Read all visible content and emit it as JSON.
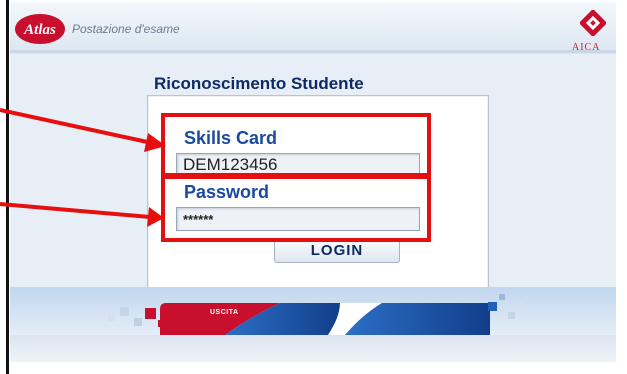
{
  "header": {
    "logo_text": "Atlas",
    "station_label": "Postazione d'esame",
    "aica_label": "AICA"
  },
  "form": {
    "title": "Riconoscimento Studente",
    "skills_card_label": "Skills Card",
    "skills_card_value": "DEM123456",
    "password_label": "Password",
    "password_value": "******",
    "login_label": "LOGIN"
  },
  "footer": {
    "exit_label": "USCITA"
  },
  "colors": {
    "annotation": "#e60f0f",
    "title": "#0e2a66",
    "field_label": "#1a4aa0",
    "footer_red": "#c8102e",
    "footer_blue": "#1f5fb8"
  },
  "icons": [
    "atlas-logo",
    "aica-logo",
    "arrow"
  ]
}
